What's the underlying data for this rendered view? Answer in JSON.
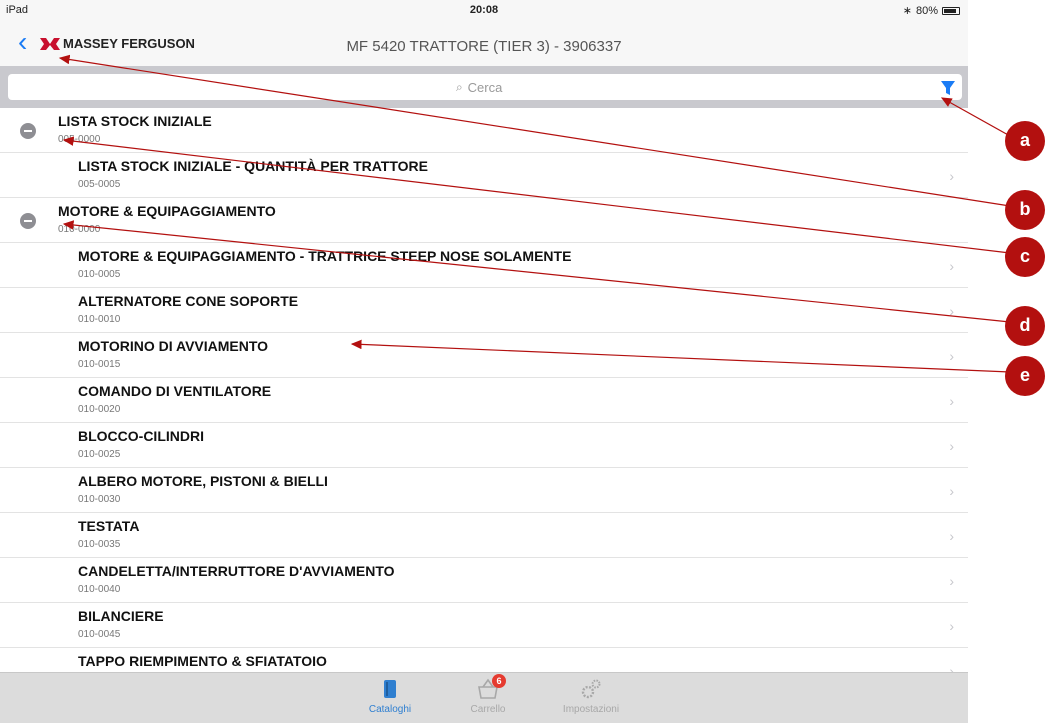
{
  "status_bar": {
    "device": "iPad",
    "time": "20:08",
    "battery": "80%"
  },
  "nav": {
    "back_glyph": "‹",
    "brand": "MASSEY FERGUSON",
    "title": "MF 5420  TRATTORE (TIER 3) - 3906337"
  },
  "search": {
    "placeholder": "Cerca",
    "icon": "search-icon",
    "filter_icon": "filter-icon",
    "accent": "#1b7cf5"
  },
  "list": {
    "sections": [
      {
        "title": "LISTA STOCK INIZIALE",
        "code": "005-0000"
      },
      {
        "title": "MOTORE & EQUIPAGGIAMENTO",
        "code": "010-0000"
      }
    ],
    "items": [
      {
        "title": "LISTA STOCK INIZIALE - QUANTITÀ PER TRATTORE",
        "code": "005-0005"
      },
      {
        "title": "MOTORE & EQUIPAGGIAMENTO - TRATTRICE STEEP NOSE SOLAMENTE",
        "code": "010-0005"
      },
      {
        "title": "ALTERNATORE CONE SOPORTE",
        "code": "010-0010"
      },
      {
        "title": "MOTORINO DI AVVIAMENTO",
        "code": "010-0015"
      },
      {
        "title": "COMANDO DI VENTILATORE",
        "code": "010-0020"
      },
      {
        "title": "BLOCCO-CILINDRI",
        "code": "010-0025"
      },
      {
        "title": "ALBERO MOTORE, PISTONI & BIELLI",
        "code": "010-0030"
      },
      {
        "title": "TESTATA",
        "code": "010-0035"
      },
      {
        "title": "CANDELETTA/INTERRUTTORE D'AVVIAMENTO",
        "code": "010-0040"
      },
      {
        "title": "BILANCIERE",
        "code": "010-0045"
      },
      {
        "title": "TAPPO RIEMPIMENTO & SFIATATOIO",
        "code": ""
      }
    ]
  },
  "tabbar": {
    "tabs": [
      {
        "label": "Cataloghi",
        "icon": "book-icon"
      },
      {
        "label": "Carrello",
        "icon": "basket-icon",
        "badge": "6"
      },
      {
        "label": "Impostazioni",
        "icon": "gears-icon"
      }
    ]
  },
  "callouts": [
    "a",
    "b",
    "c",
    "d",
    "e"
  ],
  "colors": {
    "callout": "#b3100f",
    "arrow": "#b3100f",
    "tab_active": "#2f7fd0",
    "badge": "#e53b30"
  }
}
